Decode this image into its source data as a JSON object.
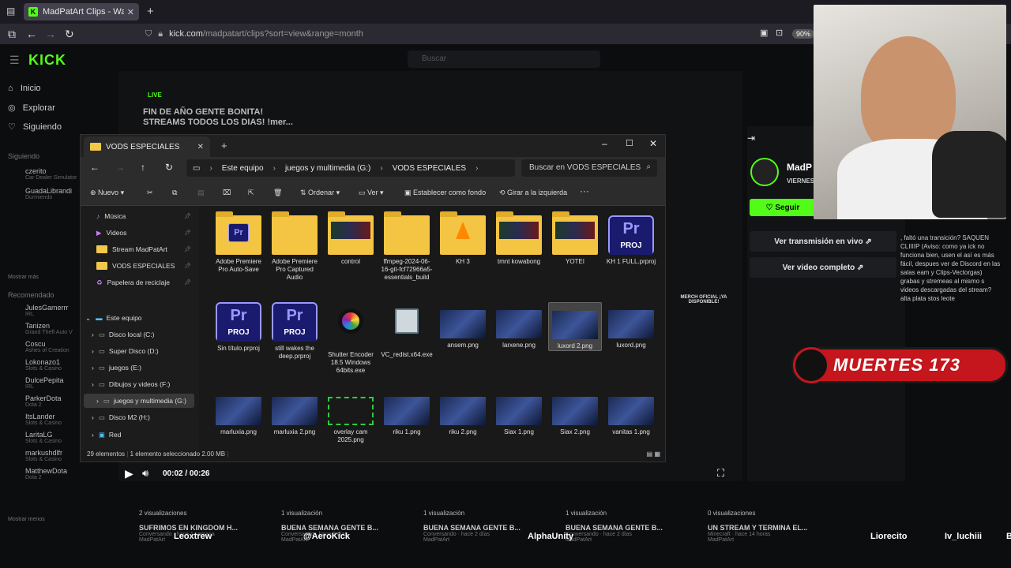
{
  "browser": {
    "tab_title": "MadPatArt Clips - Watch Live o",
    "url_host": "kick.com",
    "url_path": "/madpatart/clips?sort=view&range=month",
    "zoom": "90%"
  },
  "kick": {
    "logo": "KICK",
    "search_placeholder": "Buscar",
    "nav": [
      "Inicio",
      "Explorar",
      "Siguiendo"
    ],
    "following_label": "Siguiendo",
    "following": [
      {
        "name": "czerito",
        "sub": "Car Dealer Simulator"
      },
      {
        "name": "GuadaLibrandi",
        "sub": "Durmiendo"
      }
    ],
    "show_more": "Mostrar más",
    "recommended_label": "Recomendado",
    "recommended": [
      {
        "name": "JulesGamerrr",
        "sub": "IRL"
      },
      {
        "name": "Tanizen",
        "sub": "Grand Theft Auto V"
      },
      {
        "name": "Coscu",
        "sub": "Ashes of Creation"
      },
      {
        "name": "Lokonazo1",
        "sub": "Slots & Casino"
      },
      {
        "name": "DulcePepita",
        "sub": "IRL"
      },
      {
        "name": "ParkerDota",
        "sub": "Dota 2"
      },
      {
        "name": "ItsLander",
        "sub": "Slots & Casino"
      },
      {
        "name": "LaritaLG",
        "sub": "Slots & Casino"
      },
      {
        "name": "markushdlfr",
        "sub": "Slots & Casino"
      },
      {
        "name": "MatthewDota",
        "sub": "Dota 2"
      }
    ],
    "show_less": "Mostrar menos",
    "live_badge": "LIVE",
    "stream_title_1": "FIN DE AÑO GENTE BONITA!",
    "stream_title_2": "STREAMS TODOS LOS DIAS! !mer...",
    "channel_name": "MadP",
    "channel_sub": "VIERNES",
    "follow_label": "Seguir",
    "watch_live": "Ver transmisión en vivo",
    "watch_full": "Ver video completo",
    "chat_fragment": ", faltó una transición? SAQUEN CLIIIIP (Aviso: como ya ick no funciona bien, usen el así es más fácil, despues ver de Discord en las salas eam y Clips-Vectorgas) grabas y stremeas al mismo s videos descargadas del stream? alta plata stos leote",
    "merch": "MERCH OFICIAL ¡YA DISPONIBLE!"
  },
  "player": {
    "time": "00:02 / 00:26"
  },
  "clips": [
    {
      "views": "2 visualizaciones",
      "title": "SUFRIMOS EN KINGDOM H...",
      "meta": "Conversando · hace 1 semana",
      "author": "MadPatArt"
    },
    {
      "views": "1 visualización",
      "title": "BUENA SEMANA GENTE B...",
      "meta": "Conversando · hace 2 días",
      "author": "MadPatArt"
    },
    {
      "views": "1 visualización",
      "title": "BUENA SEMANA GENTE B...",
      "meta": "Conversando · hace 2 días",
      "author": "MadPatArt"
    },
    {
      "views": "1 visualización",
      "title": "BUENA SEMANA GENTE B...",
      "meta": "Conversando · hace 2 días",
      "author": "MadPatArt"
    },
    {
      "views": "0 visualizaciones",
      "title": "UN STREAM Y TERMINA EL...",
      "meta": "Minecraft · hace 14 horas",
      "author": "MadPatArt"
    }
  ],
  "chatters": [
    "Leoxtrew",
    "@AeroKick",
    "AlphaUnity",
    "Liorecito",
    "Iv_luchiii",
    "Blastoise2"
  ],
  "overlay": {
    "banner": "MUERTES 173"
  },
  "explorer": {
    "tab_title": "VODS ESPECIALES",
    "breadcrumb": [
      "Este equipo",
      "juegos y multimedia (G:)",
      "VODS ESPECIALES"
    ],
    "search_placeholder": "Buscar en VODS ESPECIALES",
    "toolbar": {
      "new": "Nuevo",
      "sort": "Ordenar",
      "view": "Ver",
      "set_bg": "Establecer como fondo",
      "rotate": "Girar a la izquierda"
    },
    "quick_access": [
      {
        "label": "Música",
        "icon": "music-icon"
      },
      {
        "label": "Videos",
        "icon": "video-icon"
      },
      {
        "label": "Stream MadPatArt",
        "icon": "folder-icon"
      },
      {
        "label": "VODS ESPECIALES",
        "icon": "folder-icon"
      },
      {
        "label": "Papelera de reciclaje",
        "icon": "recycle-bin-icon"
      }
    ],
    "this_pc": "Este equipo",
    "drives": [
      "Disco local (C:)",
      "Super Disco (D:)",
      "juegos (E:)",
      "Dibujos y videos (F:)",
      "juegos y multimedia (G:)",
      "Disco M2 (H:)"
    ],
    "network": "Red",
    "items": [
      {
        "name": "Adobe Premiere Pro Auto-Save",
        "kind": "folder-pr"
      },
      {
        "name": "Adobe Premiere Pro Captured Audio",
        "kind": "folder"
      },
      {
        "name": "control",
        "kind": "folder-img"
      },
      {
        "name": "ffmpeg-2024-06-16-git-fcf72966a5-essentials_build",
        "kind": "folder"
      },
      {
        "name": "KH 3",
        "kind": "folder-vlc"
      },
      {
        "name": "tmnt kowabong",
        "kind": "folder-img"
      },
      {
        "name": "YOTEI",
        "kind": "folder-img"
      },
      {
        "name": "KH 1 FULL.prproj",
        "kind": "prproj"
      },
      {
        "name": "Sin título.prproj",
        "kind": "prproj"
      },
      {
        "name": "still wakes the deep.prproj",
        "kind": "prproj"
      },
      {
        "name": "Shutter Encoder 18.5 Windows 64bits.exe",
        "kind": "exe-shutter"
      },
      {
        "name": "VC_redist.x64.exe",
        "kind": "exe"
      },
      {
        "name": "ansem.png",
        "kind": "png"
      },
      {
        "name": "larxene.png",
        "kind": "png"
      },
      {
        "name": "luxord 2.png",
        "kind": "png-sel"
      },
      {
        "name": "luxord.png",
        "kind": "png"
      },
      {
        "name": "marluxia.png",
        "kind": "png"
      },
      {
        "name": "marluxia 2.png",
        "kind": "png"
      },
      {
        "name": "overlay cam 2025.png",
        "kind": "png-frame"
      },
      {
        "name": "riku 1.png",
        "kind": "png"
      },
      {
        "name": "riku 2.png",
        "kind": "png"
      },
      {
        "name": "Siax 1.png",
        "kind": "png"
      },
      {
        "name": "Siax 2.png",
        "kind": "png"
      },
      {
        "name": "vanitas 1.png",
        "kind": "png"
      }
    ],
    "status_count": "29 elementos",
    "status_sel": "1 elemento seleccionado",
    "status_size": "2.00 MB"
  },
  "colors": {
    "kick_green": "#53fc18",
    "folder_yellow": "#f4c542",
    "premiere_purple": "#9999ff"
  }
}
